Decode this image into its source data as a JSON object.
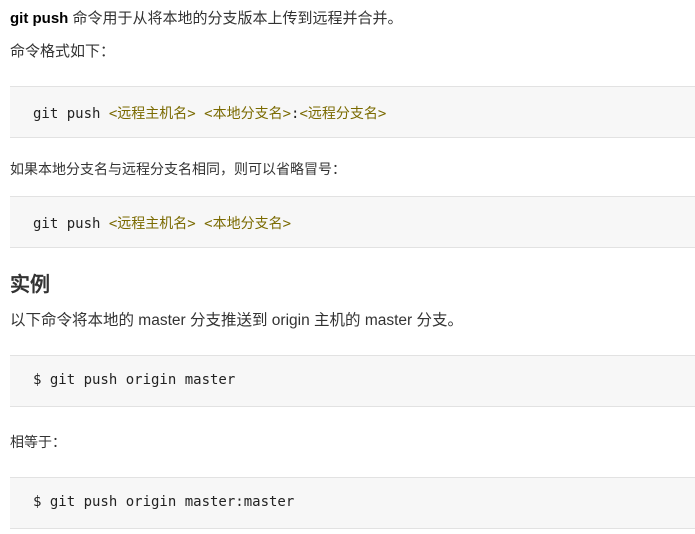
{
  "intro": {
    "command": "git push",
    "text": " 命令用于从将本地的分支版本上传到远程并合并。"
  },
  "format_label": "命令格式如下：",
  "code1": {
    "cmd": "git push ",
    "arg1": "<远程主机名>",
    "space": " ",
    "arg2": "<本地分支名>",
    "colon": ":",
    "arg3": "<远程分支名>"
  },
  "same_name_note": "如果本地分支名与远程分支名相同，则可以省略冒号：",
  "code2": {
    "cmd": "git push ",
    "arg1": "<远程主机名>",
    "space": " ",
    "arg2": "<本地分支名>"
  },
  "example_heading": "实例",
  "example_text": "以下命令将本地的 master 分支推送到 origin 主机的 master 分支。",
  "code3": "$ git push origin master",
  "equivalent_label": "相等于：",
  "code4": "$ git push origin master:master"
}
